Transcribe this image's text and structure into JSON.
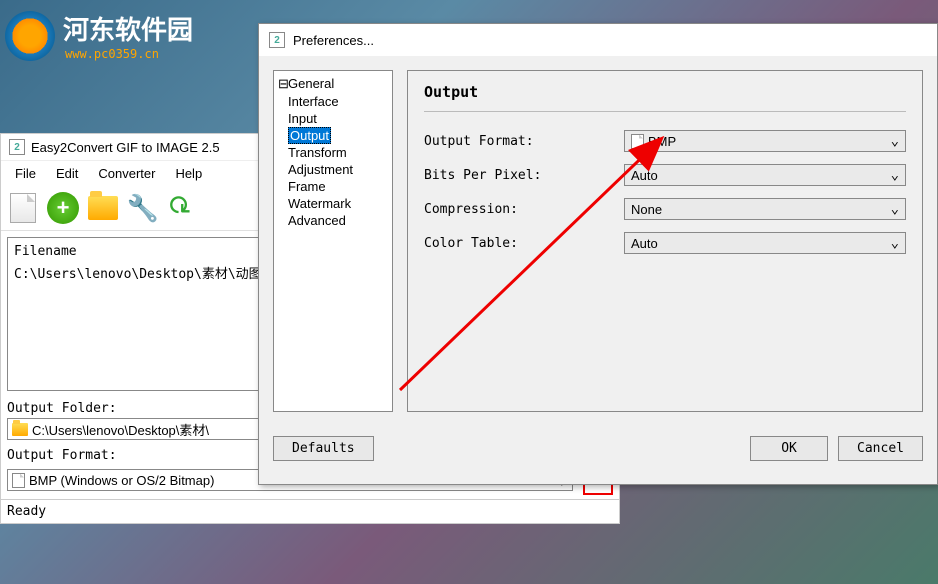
{
  "watermark": {
    "text": "河东软件园",
    "sub": "www.pc0359.cn"
  },
  "main_window": {
    "title": "Easy2Convert GIF to IMAGE 2.5",
    "menu": {
      "file": "File",
      "edit": "Edit",
      "converter": "Converter",
      "help": "Help"
    },
    "file_area": {
      "header": "Filename",
      "row": "C:\\Users\\lenovo\\Desktop\\素材\\动图"
    },
    "output_folder": {
      "label": "Output Folder:",
      "value": "C:\\Users\\lenovo\\Desktop\\素材\\"
    },
    "output_format": {
      "label": "Output Format:",
      "value": "BMP (Windows or OS/2 Bitmap)"
    },
    "statusbar": "Ready"
  },
  "preferences": {
    "title": "Preferences...",
    "tree": [
      {
        "label": "General",
        "selected": false
      },
      {
        "label": "Interface",
        "selected": false
      },
      {
        "label": "Input",
        "selected": false
      },
      {
        "label": "Output",
        "selected": true
      },
      {
        "label": "Transform",
        "selected": false
      },
      {
        "label": "Adjustment",
        "selected": false
      },
      {
        "label": "Frame",
        "selected": false
      },
      {
        "label": "Watermark",
        "selected": false
      },
      {
        "label": "Advanced",
        "selected": false
      }
    ],
    "heading": "Output",
    "rows": {
      "format": {
        "label": "Output Format:",
        "value": "BMP"
      },
      "bpp": {
        "label": "Bits Per Pixel:",
        "value": "Auto"
      },
      "compression": {
        "label": "Compression:",
        "value": "None"
      },
      "colortable": {
        "label": "Color Table:",
        "value": "Auto"
      }
    },
    "buttons": {
      "defaults": "Defaults",
      "ok": "OK",
      "cancel": "Cancel"
    }
  }
}
